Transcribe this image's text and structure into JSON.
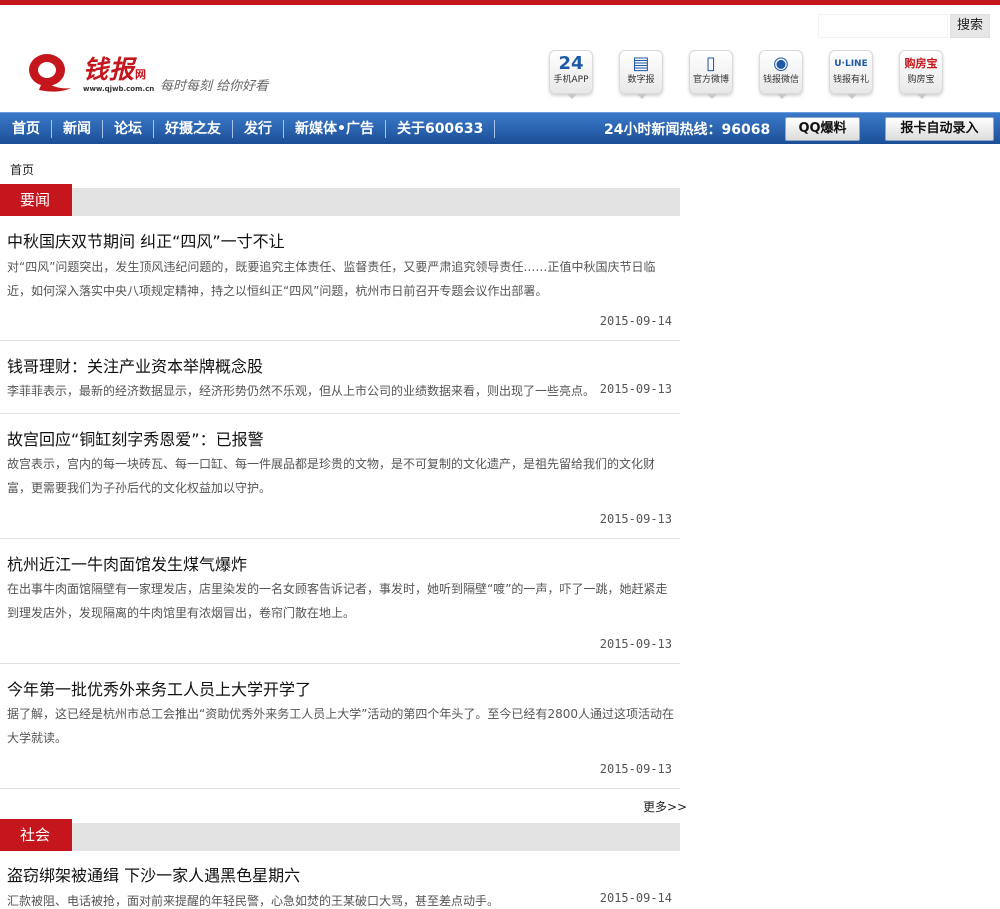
{
  "header": {
    "search": {
      "placeholder": "",
      "button_label": "搜索"
    },
    "logo": {
      "text": "钱报",
      "suffix": "网",
      "url_text": "www.qjwb.com.cn",
      "slogan": "每时每刻 给你好看"
    },
    "apps": [
      {
        "label": "手机APP",
        "icon": "phone-24-icon",
        "glyph": "24"
      },
      {
        "label": "数字报",
        "icon": "digital-paper-icon",
        "glyph": "▤"
      },
      {
        "label": "官方微博",
        "icon": "mobile-weibo-icon",
        "glyph": "▯"
      },
      {
        "label": "钱报微信",
        "icon": "wechat-icon",
        "glyph": "◉"
      },
      {
        "label": "钱报有礼",
        "icon": "u-line-icon",
        "glyph": "U·LINE"
      },
      {
        "label": "购房宝",
        "icon": "house-buying-icon",
        "glyph": "购房宝"
      }
    ]
  },
  "nav": {
    "items": [
      "首页",
      "新闻",
      "论坛",
      "好摄之友",
      "发行",
      "新媒体•广告",
      "关于600633"
    ],
    "hotline": "24小时新闻热线：96068",
    "qq_button": "QQ爆料",
    "register_button": "报卡自动录入"
  },
  "breadcrumb": "首页",
  "sections": [
    {
      "name": "要闻",
      "articles": [
        {
          "title": "中秋国庆双节期间 纠正“四风”一寸不让",
          "summary": "对“四风”问题突出，发生顶风违纪问题的，既要追究主体责任、监督责任，又要严肃追究领导责任……正值中秋国庆节日临近，如何深入落实中央八项规定精神，持之以恒纠正“四风”问题，杭州市日前召开专题会议作出部署。",
          "date": "2015-09-14"
        },
        {
          "title": "钱哥理财：关注产业资本举牌概念股",
          "summary": "李菲菲表示，最新的经济数据显示，经济形势仍然不乐观，但从上市公司的业绩数据来看，则出现了一些亮点。",
          "date": "2015-09-13"
        },
        {
          "title": "故宫回应“铜缸刻字秀恩爱”：已报警",
          "summary": "故宫表示，宫内的每一块砖瓦、每一口缸、每一件展品都是珍贵的文物，是不可复制的文化遗产，是祖先留给我们的文化财富，更需要我们为子孙后代的文化权益加以守护。",
          "date": "2015-09-13"
        },
        {
          "title": "杭州近江一牛肉面馆发生煤气爆炸",
          "summary": "在出事牛肉面馆隔壁有一家理发店，店里染发的一名女顾客告诉记者，事发时，她听到隔壁“喥”的一声，吓了一跳，她赶紧走到理发店外，发现隔离的牛肉馆里有浓烟冒出，卷帘门散在地上。",
          "date": "2015-09-13"
        },
        {
          "title": "今年第一批优秀外来务工人员上大学开学了",
          "summary": "据了解，这已经是杭州市总工会推出“资助优秀外来务工人员上大学”活动的第四个年头了。至今已经有2800人通过这项活动在大学就读。",
          "date": "2015-09-13"
        }
      ],
      "more_label": "更多>>"
    },
    {
      "name": "社会",
      "articles": [
        {
          "title": "盗窃绑架被通缉 下沙一家人遇黑色星期六",
          "summary": "汇款被阻、电话被抢，面对前来提醒的年轻民警，心急如焚的王某破口大骂，甚至差点动手。",
          "date": "2015-09-14"
        }
      ]
    }
  ],
  "colors": {
    "brand_red": "#c5161d",
    "nav_blue": "#2a62b0"
  }
}
